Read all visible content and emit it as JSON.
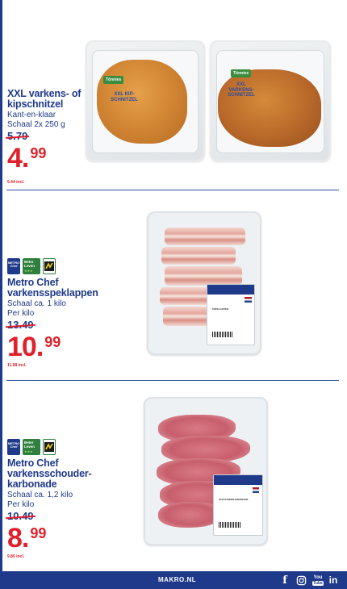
{
  "products": [
    {
      "name": "XXL varkens- of kipschnitzel",
      "desc1": "Kant-en-klaar",
      "desc2": "Schaal 2x 250 g",
      "old_price": "5.79",
      "price_whole": "4",
      "price_cents": "99",
      "incl": "5.44 incl.",
      "pack_label_1": "XXL KIP-SCHNITZEL",
      "pack_label_2": "XXL VARKENS-SCHNITZEL",
      "brand": "Tönnies"
    },
    {
      "name": "Metro Chef varkensspeklappen",
      "desc1": "Schaal ca. 1 kilo",
      "desc2": "Per kilo",
      "old_price": "13.49",
      "price_whole": "10",
      "price_cents": "99",
      "incl": "11.98 incl.",
      "badge_metro": "METRO",
      "badge_chef": "Chef",
      "badge_bl": "Beter Leven",
      "badge_stars": "★★★",
      "meat_label": "SPEKLAPPEN"
    },
    {
      "name": "Metro Chef varkensschouder-karbonade",
      "desc1": "Schaal ca. 1,2 kilo",
      "desc2": "Per kilo",
      "old_price": "10.49",
      "price_whole": "8",
      "price_cents": "99",
      "incl": "9.80 incl.",
      "badge_metro": "METRO",
      "badge_chef": "Chef",
      "badge_bl": "Beter Leven",
      "badge_stars": "★★★",
      "meat_label": "SCHOUDERKARBONADE"
    }
  ],
  "footer": {
    "url": "MAKRO.NL",
    "icons": [
      "facebook-icon",
      "instagram-icon",
      "youtube-icon",
      "linkedin-icon"
    ],
    "fb": "f",
    "yt_top": "You",
    "yt_bottom": "Tube",
    "li": "in"
  },
  "colors": {
    "brand_blue": "#1f3a8a",
    "price_red": "#e0202a",
    "beter_leven_green": "#2f7f3e"
  }
}
